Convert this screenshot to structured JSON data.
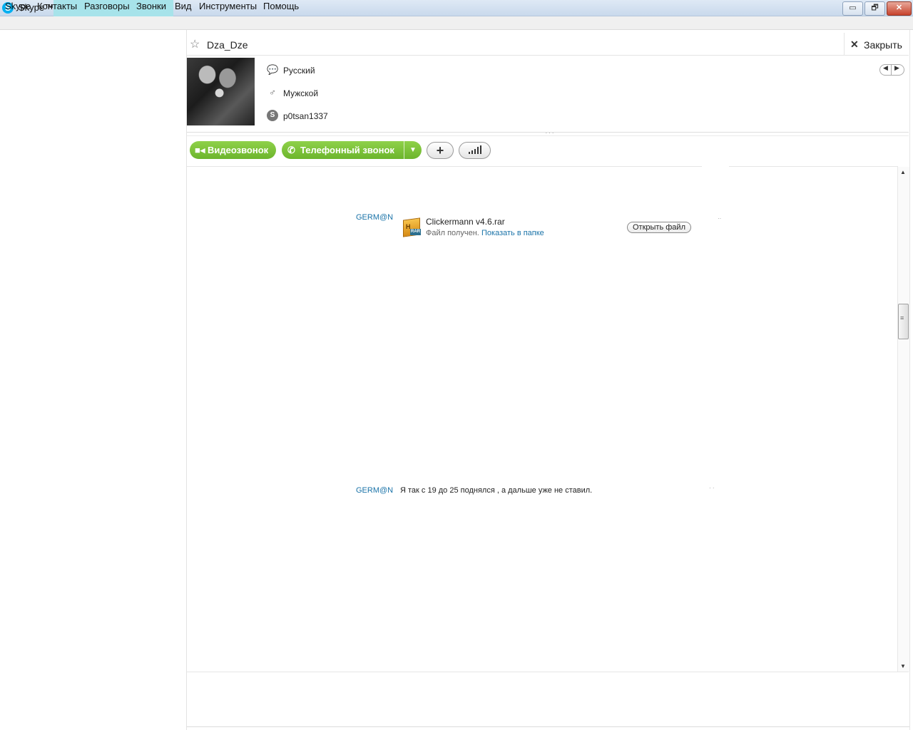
{
  "window": {
    "title": "Skype™ -",
    "minimize": "▭",
    "maximize": "🗗",
    "close": "✕"
  },
  "menu": {
    "items": [
      "Skype",
      "Контакты",
      "Разговоры",
      "Звонки",
      "Вид",
      "Инструменты",
      "Помощь"
    ]
  },
  "contact": {
    "name": "Dza_Dze",
    "close_label": "Закрыть",
    "language": "Русский",
    "gender": "Мужской",
    "skype_name": "p0tsan1337"
  },
  "call_bar": {
    "video_label": "Видеозвонок",
    "phone_label": "Телефонный звонок",
    "add_symbol": "+"
  },
  "chat": {
    "messages": [
      {
        "sender": "GERM@N",
        "file": {
          "name": "Clickermann v4.6.rar",
          "status": "Файл получен.",
          "show_in_folder": "Показать в папке",
          "open_label": "Открыть файл",
          "icon": "rar-archive-icon"
        }
      },
      {
        "sender": "GERM@N",
        "text": "Я так с 19 до 25 поднялся , а дальше уже не ставил."
      }
    ]
  },
  "icons": {
    "star": "star-icon",
    "language": "speech-bubble-icon",
    "gender": "male-symbol-icon",
    "skype": "skype-logo-icon"
  },
  "colors": {
    "accent_green": "#7cc23a",
    "link_blue": "#1a73a8",
    "skype_blue": "#00aff0"
  }
}
